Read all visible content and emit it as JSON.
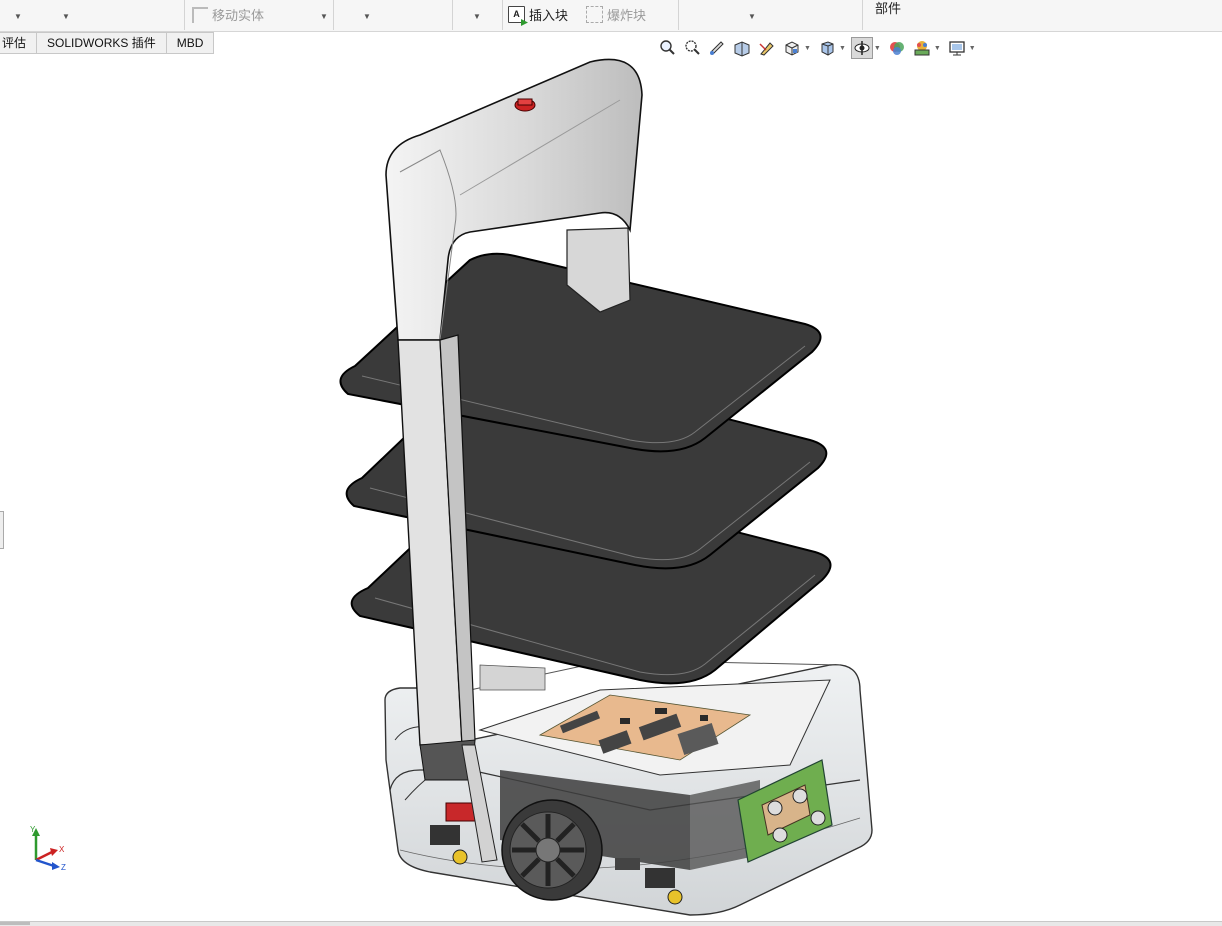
{
  "ribbon": {
    "move_body_label": "移动实体",
    "insert_block_label": "插入块",
    "explode_block_label": "爆炸块",
    "component_label": "部件"
  },
  "tabs": [
    {
      "label": "评估"
    },
    {
      "label": "SOLIDWORKS 插件"
    },
    {
      "label": "MBD"
    }
  ],
  "view_toolbar": {
    "icons": [
      "zoom-to-fit-icon",
      "zoom-to-area-icon",
      "previous-view-icon",
      "section-view-icon",
      "dynamic-annotation-icon",
      "view-orientation-icon",
      "display-style-icon",
      "hide-show-items-icon",
      "edit-appearance-icon",
      "apply-scene-icon",
      "view-settings-icon"
    ]
  },
  "triad": {
    "x": "X",
    "y": "Y",
    "z": "Z"
  },
  "colors": {
    "ribbon_bg": "#f6f6f6",
    "tray": "#3a3a3a",
    "frame": "#e3e3e3",
    "pcb": "#e8b98e",
    "estop": "#cc2222",
    "motor_board": "#6fae4f",
    "wheel": "#4a4a4a",
    "caster": "#e8c22a"
  }
}
